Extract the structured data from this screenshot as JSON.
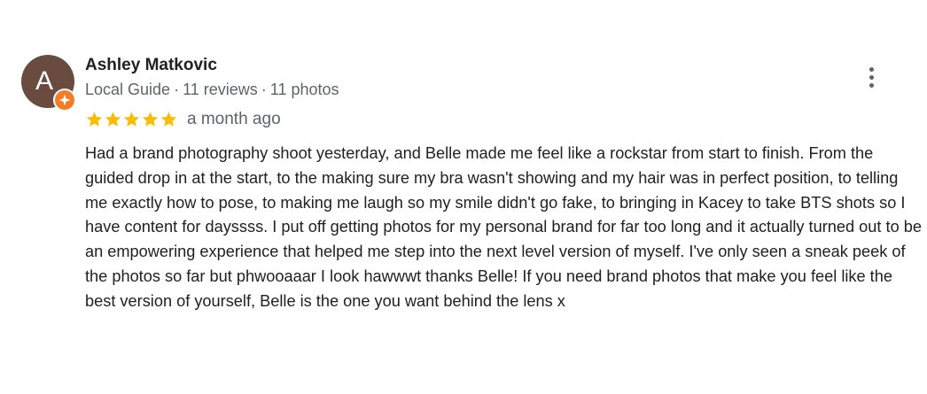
{
  "review": {
    "author": {
      "initial": "A",
      "name": "Ashley Matkovic",
      "badge": "Local Guide",
      "reviews_count": "11 reviews",
      "photos_count": "11 photos",
      "separator": "·",
      "avatar_color": "#6a4b3f",
      "badge_color": "#f57c26"
    },
    "rating": {
      "stars": 5,
      "max_stars": 5,
      "star_color": "#fbbc04"
    },
    "date": "a month ago",
    "text": "Had a brand photography shoot yesterday, and Belle made me feel like a rockstar from start to finish. From the guided drop in at the start, to the making sure my bra wasn't showing and my hair was in perfect position, to telling me exactly how to pose, to making me laugh so my smile didn't go fake, to bringing in Kacey to take BTS shots so I have content for dayssss. I put off getting photos for my personal brand for far too long and it actually turned out to be an empowering experience that helped me step into the next level version of myself. I've only seen a sneak peek of the photos so far but phwooaaar I look hawwwt thanks Belle! If you need brand photos that make you feel like the best version of yourself, Belle is the one you want behind the lens x"
  },
  "icons": {
    "menu": "more-vert-icon",
    "badge": "local-guide-badge-icon",
    "star": "star-icon"
  }
}
